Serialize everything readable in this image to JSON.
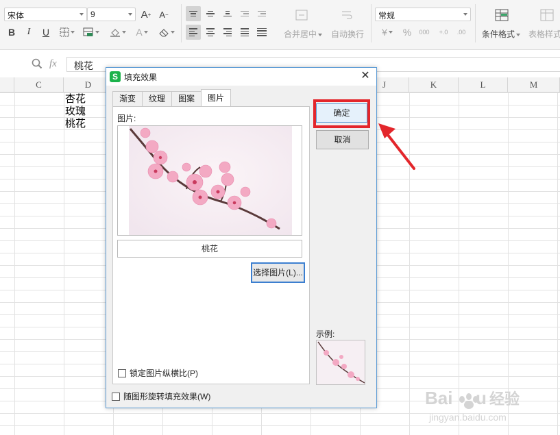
{
  "ribbon": {
    "font_name": "宋体",
    "font_size": "9",
    "number_format": "常规",
    "merge_center": "合并居中",
    "auto_wrap": "自动换行",
    "conditional_format": "条件格式",
    "table_style": "表格样式"
  },
  "formula_bar": {
    "fx_label": "fx",
    "cell_content": "桃花"
  },
  "sheet": {
    "columns": [
      "C",
      "D",
      "J",
      "K",
      "L",
      "M"
    ],
    "cells": [
      "杏花",
      "玫瑰",
      "桃花"
    ]
  },
  "dialog": {
    "title": "填充效果",
    "close_glyph": "✕",
    "tabs": [
      "渐变",
      "纹理",
      "图案",
      "图片"
    ],
    "active_tab": "图片",
    "picture_label": "图片:",
    "picture_name": "桃花",
    "choose_picture": "选择图片(L)...",
    "lock_aspect": "锁定图片纵横比(P)",
    "rotate_with_shape": "随图形旋转填充效果(W)",
    "ok": "确定",
    "cancel": "取消",
    "sample_label": "示例:"
  },
  "watermark": {
    "brand": "Baidu经验",
    "url": "jingyan.baidu.com"
  },
  "colors": {
    "highlight": "#e3262b",
    "dialog_border": "#5b9bd5",
    "app_icon": "#1bb24b"
  }
}
